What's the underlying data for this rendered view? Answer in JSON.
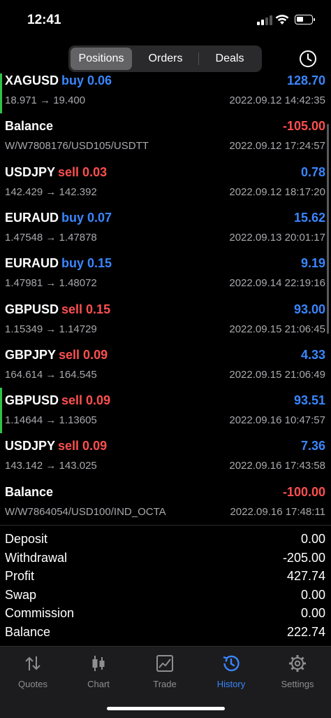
{
  "status": {
    "time": "12:41"
  },
  "tabs_top": {
    "positions": "Positions",
    "orders": "Orders",
    "deals": "Deals"
  },
  "deals": [
    {
      "symbol": "XAGUSD",
      "dir": "buy 0.06",
      "type": "buy",
      "prices": "18.971 → 19.400",
      "pnl": "128.70",
      "sign": "pos",
      "time": "2022.09.12 14:42:35",
      "marked": true
    },
    {
      "symbol": "Balance",
      "dir": "",
      "type": "",
      "prices": "W/W7808176/USD105/USDTT",
      "pnl": "-105.00",
      "sign": "neg",
      "time": "2022.09.12 17:24:57",
      "marked": false
    },
    {
      "symbol": "USDJPY",
      "dir": "sell 0.03",
      "type": "sell",
      "prices": "142.429 → 142.392",
      "pnl": "0.78",
      "sign": "pos",
      "time": "2022.09.12 18:17:20",
      "marked": false
    },
    {
      "symbol": "EURAUD",
      "dir": "buy 0.07",
      "type": "buy",
      "prices": "1.47548 → 1.47878",
      "pnl": "15.62",
      "sign": "pos",
      "time": "2022.09.13 20:01:17",
      "marked": false
    },
    {
      "symbol": "EURAUD",
      "dir": "buy 0.15",
      "type": "buy",
      "prices": "1.47981 → 1.48072",
      "pnl": "9.19",
      "sign": "pos",
      "time": "2022.09.14 22:19:16",
      "marked": false
    },
    {
      "symbol": "GBPUSD",
      "dir": "sell 0.15",
      "type": "sell",
      "prices": "1.15349 → 1.14729",
      "pnl": "93.00",
      "sign": "pos",
      "time": "2022.09.15 21:06:45",
      "marked": false
    },
    {
      "symbol": "GBPJPY",
      "dir": "sell 0.09",
      "type": "sell",
      "prices": "164.614 → 164.545",
      "pnl": "4.33",
      "sign": "pos",
      "time": "2022.09.15 21:06:49",
      "marked": false
    },
    {
      "symbol": "GBPUSD",
      "dir": "sell 0.09",
      "type": "sell",
      "prices": "1.14644 → 1.13605",
      "pnl": "93.51",
      "sign": "pos",
      "time": "2022.09.16 10:47:57",
      "marked": true
    },
    {
      "symbol": "USDJPY",
      "dir": "sell 0.09",
      "type": "sell",
      "prices": "143.142 → 143.025",
      "pnl": "7.36",
      "sign": "pos",
      "time": "2022.09.16 17:43:58",
      "marked": false
    },
    {
      "symbol": "Balance",
      "dir": "",
      "type": "",
      "prices": "W/W7864054/USD100/IND_OCTA",
      "pnl": "-100.00",
      "sign": "neg",
      "time": "2022.09.16 17:48:11",
      "marked": false
    }
  ],
  "summary": [
    {
      "label": "Deposit",
      "value": "0.00"
    },
    {
      "label": "Withdrawal",
      "value": "-205.00"
    },
    {
      "label": "Profit",
      "value": "427.74"
    },
    {
      "label": "Swap",
      "value": "0.00"
    },
    {
      "label": "Commission",
      "value": "0.00"
    },
    {
      "label": "Balance",
      "value": "222.74"
    }
  ],
  "tabbar": {
    "quotes": "Quotes",
    "chart": "Chart",
    "trade": "Trade",
    "history": "History",
    "settings": "Settings",
    "active_color": "#3a86ff",
    "inactive_color": "#8e8e93"
  },
  "colors": {
    "buy": "#3a86ff",
    "sell": "#ff4f4f",
    "profit": "#3a86ff",
    "loss": "#ff4f4f",
    "marker": "#30c24a"
  }
}
